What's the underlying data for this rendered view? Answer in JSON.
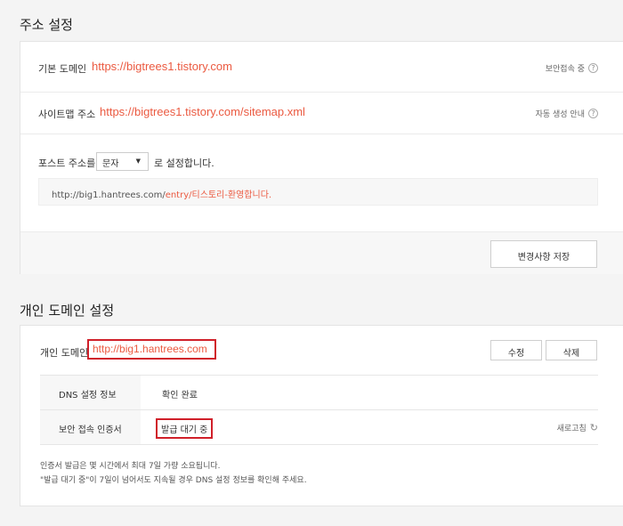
{
  "address": {
    "title": "주소 설정",
    "basic_domain_label": "기본 도메인",
    "basic_domain_url": "https://bigtrees1.tistory.com",
    "secure_status": "보안접속 중",
    "sitemap_label": "사이트맵 주소",
    "sitemap_url": "https://bigtrees1.tistory.com/sitemap.xml",
    "auto_generation": "자동 생성 안내",
    "post_addr_prefix": "포스트 주소를",
    "post_addr_option": "문자",
    "post_addr_suffix": "로 설정합니다.",
    "example_base": "http://big1.hantrees.com/",
    "example_path": "entry/티스토리-환영합니다.",
    "save_button": "변경사항 저장"
  },
  "custom_domain": {
    "title": "개인 도메인 설정",
    "label": "개인 도메인",
    "url": "http://big1.hantrees.com",
    "edit_button": "수정",
    "delete_button": "삭제",
    "dns_label": "DNS 설정 정보",
    "dns_value": "확인 완료",
    "cert_label": "보안 접속 인증서",
    "cert_value": "발급 대기 중",
    "refresh_label": "새로고침",
    "note_line1": "인증서 발급은 몇 시간에서 최대 7일 가량 소요됩니다.",
    "note_line2": "\"발급 대기 중\"이 7일이 넘어서도 지속될 경우 DNS 설정 정보를 확인해 주세요."
  },
  "colors": {
    "accent": "#eb5a41",
    "highlight_box": "#d0202a"
  }
}
